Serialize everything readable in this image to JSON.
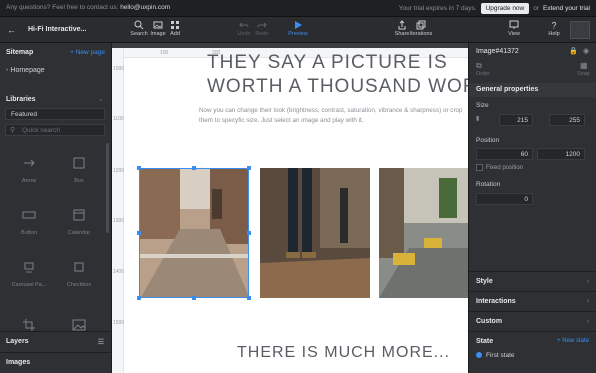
{
  "trial_bar": {
    "questions_text": "Any questions? Feel free to contact us:",
    "email": "hello@uxpin.com",
    "trial_expires": "Your trial expires in 7 days.",
    "upgrade_label": "Upgrade now",
    "or_text": "or",
    "extend_label": "Extend your trial"
  },
  "toolbar": {
    "project_title": "Hi-Fi Interactive...",
    "search_label": "Search",
    "image_label": "Image",
    "add_label": "Add",
    "undo_label": "Undo",
    "redo_label": "Redo",
    "preview_label": "Preview",
    "share_label": "Share",
    "iterations_label": "Iterations",
    "view_label": "View",
    "help_label": "Help"
  },
  "sidebar": {
    "sitemap_title": "Sitemap",
    "new_page_label": "+ New page",
    "page_item": "Homepage",
    "libraries_title": "Libraries",
    "library_selected": "Featured",
    "search_placeholder": "Quick search",
    "components": [
      {
        "label": "Arrow",
        "icon": "arrow-icon"
      },
      {
        "label": "Box",
        "icon": "box-icon"
      },
      {
        "label": "Button",
        "icon": "button-icon"
      },
      {
        "label": "Calendar",
        "icon": "calendar-icon"
      },
      {
        "label": "Carousel Pa...",
        "icon": "carousel-icon"
      },
      {
        "label": "Checkbox",
        "icon": "checkbox-icon"
      },
      {
        "label": "",
        "icon": "crop-icon"
      },
      {
        "label": "",
        "icon": "image-icon"
      }
    ],
    "layers_title": "Layers",
    "images_title": "Images"
  },
  "canvas": {
    "ruler_top": [
      "100",
      "200"
    ],
    "ruler_left": [
      "1000",
      "1100",
      "1200",
      "1300",
      "1400",
      "1500"
    ],
    "headline_1": "THEY SAY A PICTURE IS",
    "headline_2": "WORTH A THOUSAND WOR",
    "paragraph": "Now you can change their look (brightness, contrast, saturation, vibrance & sharpness) or crop them to specyfic size. Just select an image and play with it.",
    "more_heading": "THERE IS MUCH MORE..."
  },
  "properties": {
    "element_id": "Image#41372",
    "order_label": "Order",
    "snap_label": "Snap",
    "general_title": "General properties",
    "size_label": "Size",
    "width": "215",
    "height": "255",
    "position_label": "Position",
    "x": "60",
    "y": "1200",
    "fixed_position_label": "Fixed position",
    "rotation_label": "Rotation",
    "rotation": "0",
    "style_title": "Style",
    "interactions_title": "Interactions",
    "custom_title": "Custom",
    "state_title": "State",
    "new_state_label": "+ New state",
    "first_state_label": "First state"
  },
  "colors": {
    "accent": "#3b8ef0",
    "panel": "#2e3034",
    "canvas": "#ffffff"
  }
}
